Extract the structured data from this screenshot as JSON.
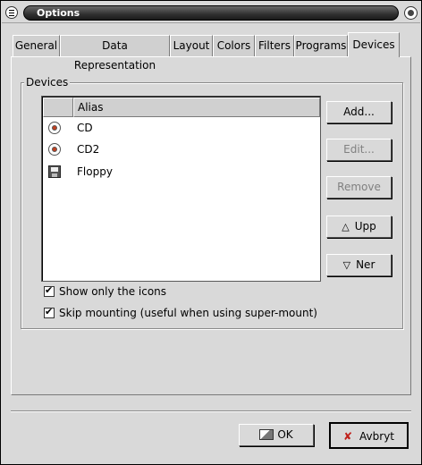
{
  "window": {
    "title": "Options"
  },
  "tabs": [
    {
      "label": "General"
    },
    {
      "label": "Data Representation"
    },
    {
      "label": "Layout"
    },
    {
      "label": "Colors"
    },
    {
      "label": "Filters"
    },
    {
      "label": "Programs"
    },
    {
      "label": "Devices",
      "active": true
    }
  ],
  "devices_group": {
    "label": "Devices",
    "list": {
      "columns": [
        "",
        "Alias"
      ],
      "rows": [
        {
          "icon": "cd-icon",
          "alias": "CD"
        },
        {
          "icon": "cd-icon",
          "alias": "CD2"
        },
        {
          "icon": "floppy-icon",
          "alias": "Floppy"
        }
      ]
    },
    "buttons": {
      "add": "Add...",
      "edit": "Edit...",
      "remove": "Remove",
      "up": "Upp",
      "down": "Ner"
    },
    "options": [
      {
        "label": "Show only the icons",
        "checked": true
      },
      {
        "label": "Skip mounting (useful when using super-mount)",
        "checked": true
      }
    ]
  },
  "footer": {
    "ok": "OK",
    "cancel": "Avbryt"
  }
}
